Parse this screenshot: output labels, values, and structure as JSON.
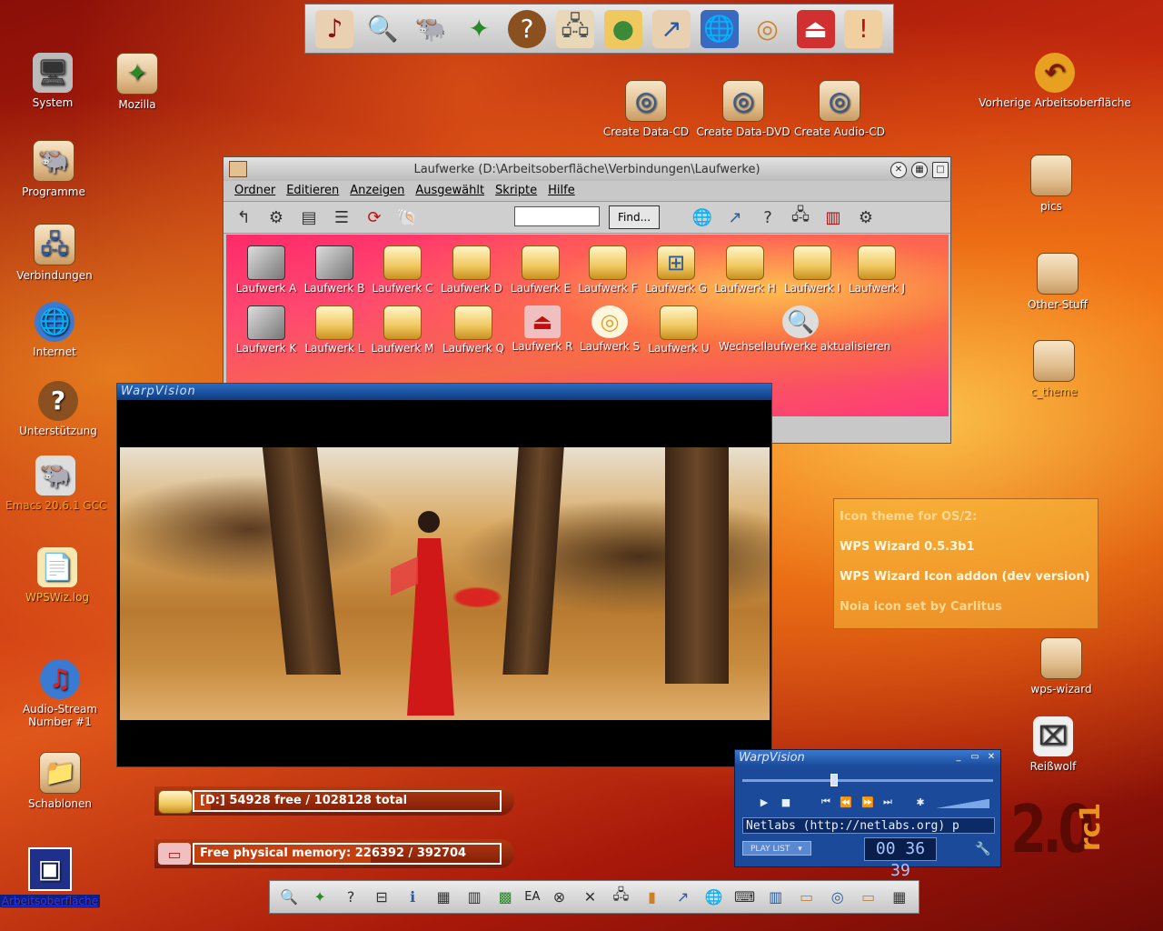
{
  "desktop_left": [
    {
      "label": "System",
      "icon": "computer-icon",
      "glyph": "🖥"
    },
    {
      "label": "Mozilla",
      "icon": "mozilla-icon",
      "glyph": "✦"
    },
    {
      "label": "Programme",
      "icon": "programs-icon",
      "glyph": "🐃"
    },
    {
      "label": "Verbindungen",
      "icon": "connections-icon",
      "glyph": "🖧"
    },
    {
      "label": "Internet",
      "icon": "globe-icon",
      "glyph": "🌐"
    },
    {
      "label": "Unterstützung",
      "icon": "help-icon",
      "glyph": "?"
    },
    {
      "label": "Emacs 20.6.1 GCC",
      "icon": "gnu-icon",
      "glyph": "🐃"
    },
    {
      "label": "WPSWiz.log",
      "icon": "log-file-icon",
      "glyph": "📄"
    },
    {
      "label": "Audio-Stream Number #1",
      "icon": "audio-stream-icon",
      "glyph": "♫"
    },
    {
      "label": "Schablonen",
      "icon": "templates-icon",
      "glyph": "📁"
    },
    {
      "label": "Arbeitsoberfläche",
      "icon": "desktop-icon",
      "glyph": "▣"
    }
  ],
  "desktop_top": [
    {
      "label": "Create Data-CD",
      "icon": "create-data-cd-icon"
    },
    {
      "label": "Create Data-DVD",
      "icon": "create-data-dvd-icon"
    },
    {
      "label": "Create Audio-CD",
      "icon": "create-audio-cd-icon"
    }
  ],
  "desktop_right": [
    {
      "label": "Vorherige Arbeitsoberfläche",
      "icon": "previous-desktop-icon",
      "glyph": "↶"
    },
    {
      "label": "pics",
      "icon": "folder-icon"
    },
    {
      "label": "Other-Stuff",
      "icon": "folder-icon"
    },
    {
      "label": "c_theme",
      "icon": "folder-icon"
    },
    {
      "label": "wps-wizard",
      "icon": "folder-icon"
    },
    {
      "label": "Reißwolf",
      "icon": "shredder-icon",
      "glyph": "⌧"
    }
  ],
  "drives_window": {
    "title": "Laufwerke (D:\\Arbeitsoberfläche\\Verbindungen\\Laufwerke)",
    "menu": [
      "Ordner",
      "Editieren",
      "Anzeigen",
      "Ausgewählt",
      "Skripte",
      "Hilfe"
    ],
    "find_label": "Find...",
    "drives_row1": [
      "Laufwerk A",
      "Laufwerk B",
      "Laufwerk C",
      "Laufwerk D",
      "Laufwerk E",
      "Laufwerk F",
      "Laufwerk G",
      "Laufwerk H",
      "Laufwerk I",
      "Laufwerk J"
    ],
    "drives_row2": [
      "Laufwerk K",
      "Laufwerk L",
      "Laufwerk M",
      "Laufwerk Q",
      "Laufwerk R",
      "Laufwerk S",
      "Laufwerk U",
      "Wechsellaufwerke aktualisieren"
    ]
  },
  "video_window": {
    "title": "WarpVision"
  },
  "info_box": [
    "Icon theme for OS/2:",
    "WPS Wizard 0.5.3b1",
    "WPS Wizard Icon addon (dev version)",
    "Noia icon set by Carlitus"
  ],
  "disk_status": {
    "text": "[D:] 54928 free / 1028128 total",
    "fraction": 0.053
  },
  "memory_status": {
    "text": "Free physical memory: 226392 / 392704",
    "fraction": 0.576
  },
  "player": {
    "title": "WarpVision",
    "marquee": "Netlabs (http://netlabs.org) p",
    "playlist_label": "PLAY LIST",
    "time": "00 36 39",
    "seek_fraction": 0.35
  },
  "bottom_bar": {
    "ea_label": "EA"
  },
  "version": {
    "main": "2.0",
    "suffix": "rc1"
  },
  "colors": {
    "accent": "#c24010",
    "player_bg": "#1c4a9a",
    "drives_bg": "#ff3a7a"
  }
}
